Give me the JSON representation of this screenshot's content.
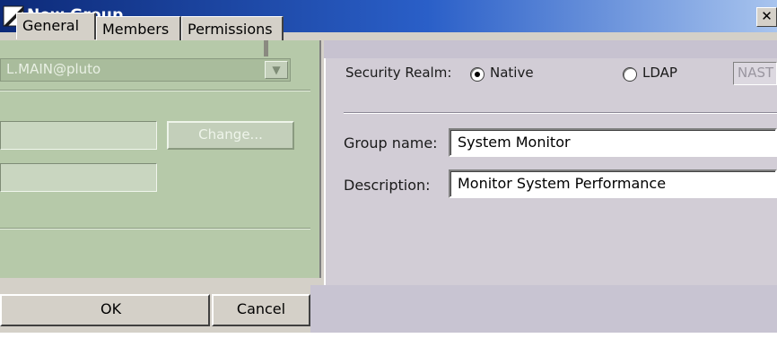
{
  "window": {
    "title": "New Group",
    "close_glyph": "✕"
  },
  "tabs": [
    {
      "label": "General",
      "active": true
    },
    {
      "label": "Members",
      "active": false
    },
    {
      "label": "Permissions",
      "active": false
    }
  ],
  "left_panel": {
    "realm_combo_value": "L.MAIN@pluto",
    "combo_arrow_glyph": "▼",
    "change_button_label": "Change..."
  },
  "right_panel": {
    "security_realm_label": "Security Realm:",
    "radio_native_label": "Native",
    "radio_ldap_label": "LDAP",
    "selected_realm": "Native",
    "ldap_server_value": "NAST",
    "group_name_label": "Group name:",
    "group_name_value": "System Monitor",
    "description_label": "Description:",
    "description_value": "Monitor System Performance"
  },
  "buttons": {
    "ok_label": "OK",
    "cancel_label": "Cancel"
  },
  "colors": {
    "titlebar_start": "#0d2a78",
    "titlebar_end": "#a8c4ee",
    "left_panel_tint": "#b6c9a9",
    "right_panel_tint": "#d2cdd6"
  },
  "icons": {
    "title_icon": "app-window-icon",
    "close_icon": "close-icon",
    "dropdown_icon": "chevron-down-icon",
    "radio_icon": "radio-icon"
  }
}
